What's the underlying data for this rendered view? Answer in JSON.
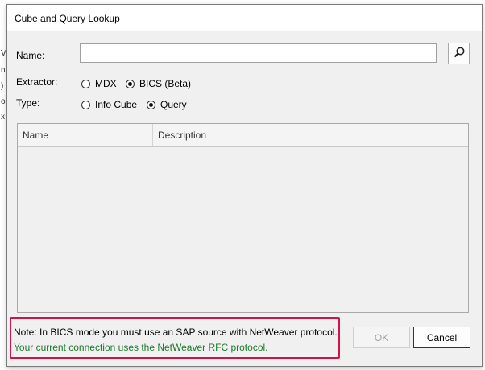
{
  "background_glyphs": [
    "V",
    "n",
    ")",
    "o",
    "x"
  ],
  "dialog": {
    "title": "Cube and Query Lookup",
    "name_label": "Name:",
    "name_value": "",
    "search_icon": "search-icon",
    "extractor_label": "Extractor:",
    "extractor_options": [
      {
        "label": "MDX",
        "checked": false
      },
      {
        "label": "BICS (Beta)",
        "checked": true
      }
    ],
    "type_label": "Type:",
    "type_options": [
      {
        "label": "Info Cube",
        "checked": false
      },
      {
        "label": "Query",
        "checked": true
      }
    ],
    "table": {
      "columns": [
        "Name",
        "Description"
      ],
      "rows": []
    },
    "note_line1": "Note: In BICS mode you must use an SAP source with NetWeaver protocol.",
    "note_line2": "Your current connection uses the NetWeaver RFC protocol.",
    "ok_label": "OK",
    "ok_enabled": false,
    "cancel_label": "Cancel"
  },
  "colors": {
    "highlight_border": "#d4124a",
    "success_text": "#1a7a2a",
    "dialog_bg": "#f0f0f0"
  }
}
